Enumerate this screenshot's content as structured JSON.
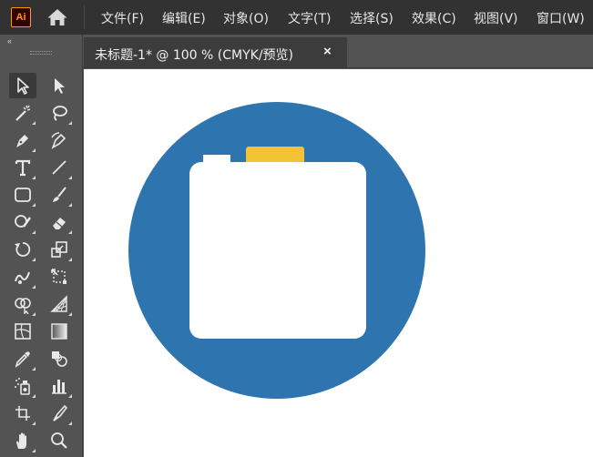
{
  "app": {
    "logo_text": "Ai",
    "logo_color": "#ff9a00"
  },
  "menu": {
    "items": [
      "文件(F)",
      "编辑(E)",
      "对象(O)",
      "文字(T)",
      "选择(S)",
      "效果(C)",
      "视图(V)",
      "窗口(W)"
    ]
  },
  "toolbar": {
    "collapse_glyph": "‹‹",
    "tools": [
      "selection-tool",
      "direct-selection-tool",
      "magic-wand-tool",
      "lasso-tool",
      "pen-tool",
      "curvature-tool",
      "type-tool",
      "line-segment-tool",
      "rounded-rectangle-tool",
      "paintbrush-tool",
      "shaper-tool",
      "eraser-tool",
      "rotate-tool",
      "scale-tool",
      "warp-tool",
      "free-transform-tool",
      "shape-builder-tool",
      "perspective-grid-tool",
      "mesh-tool",
      "gradient-tool",
      "eyedropper-tool",
      "blend-tool",
      "symbol-sprayer-tool",
      "column-graph-tool",
      "artboard-tool",
      "slice-tool",
      "hand-tool",
      "zoom-tool"
    ]
  },
  "document": {
    "tab_title": "未标题-1* @ 100 % (CMYK/预览)",
    "close_glyph": "×"
  },
  "artwork": {
    "circle_color": "#2e75b0",
    "tab_color": "#f2c433",
    "body_color": "#ffffff"
  }
}
